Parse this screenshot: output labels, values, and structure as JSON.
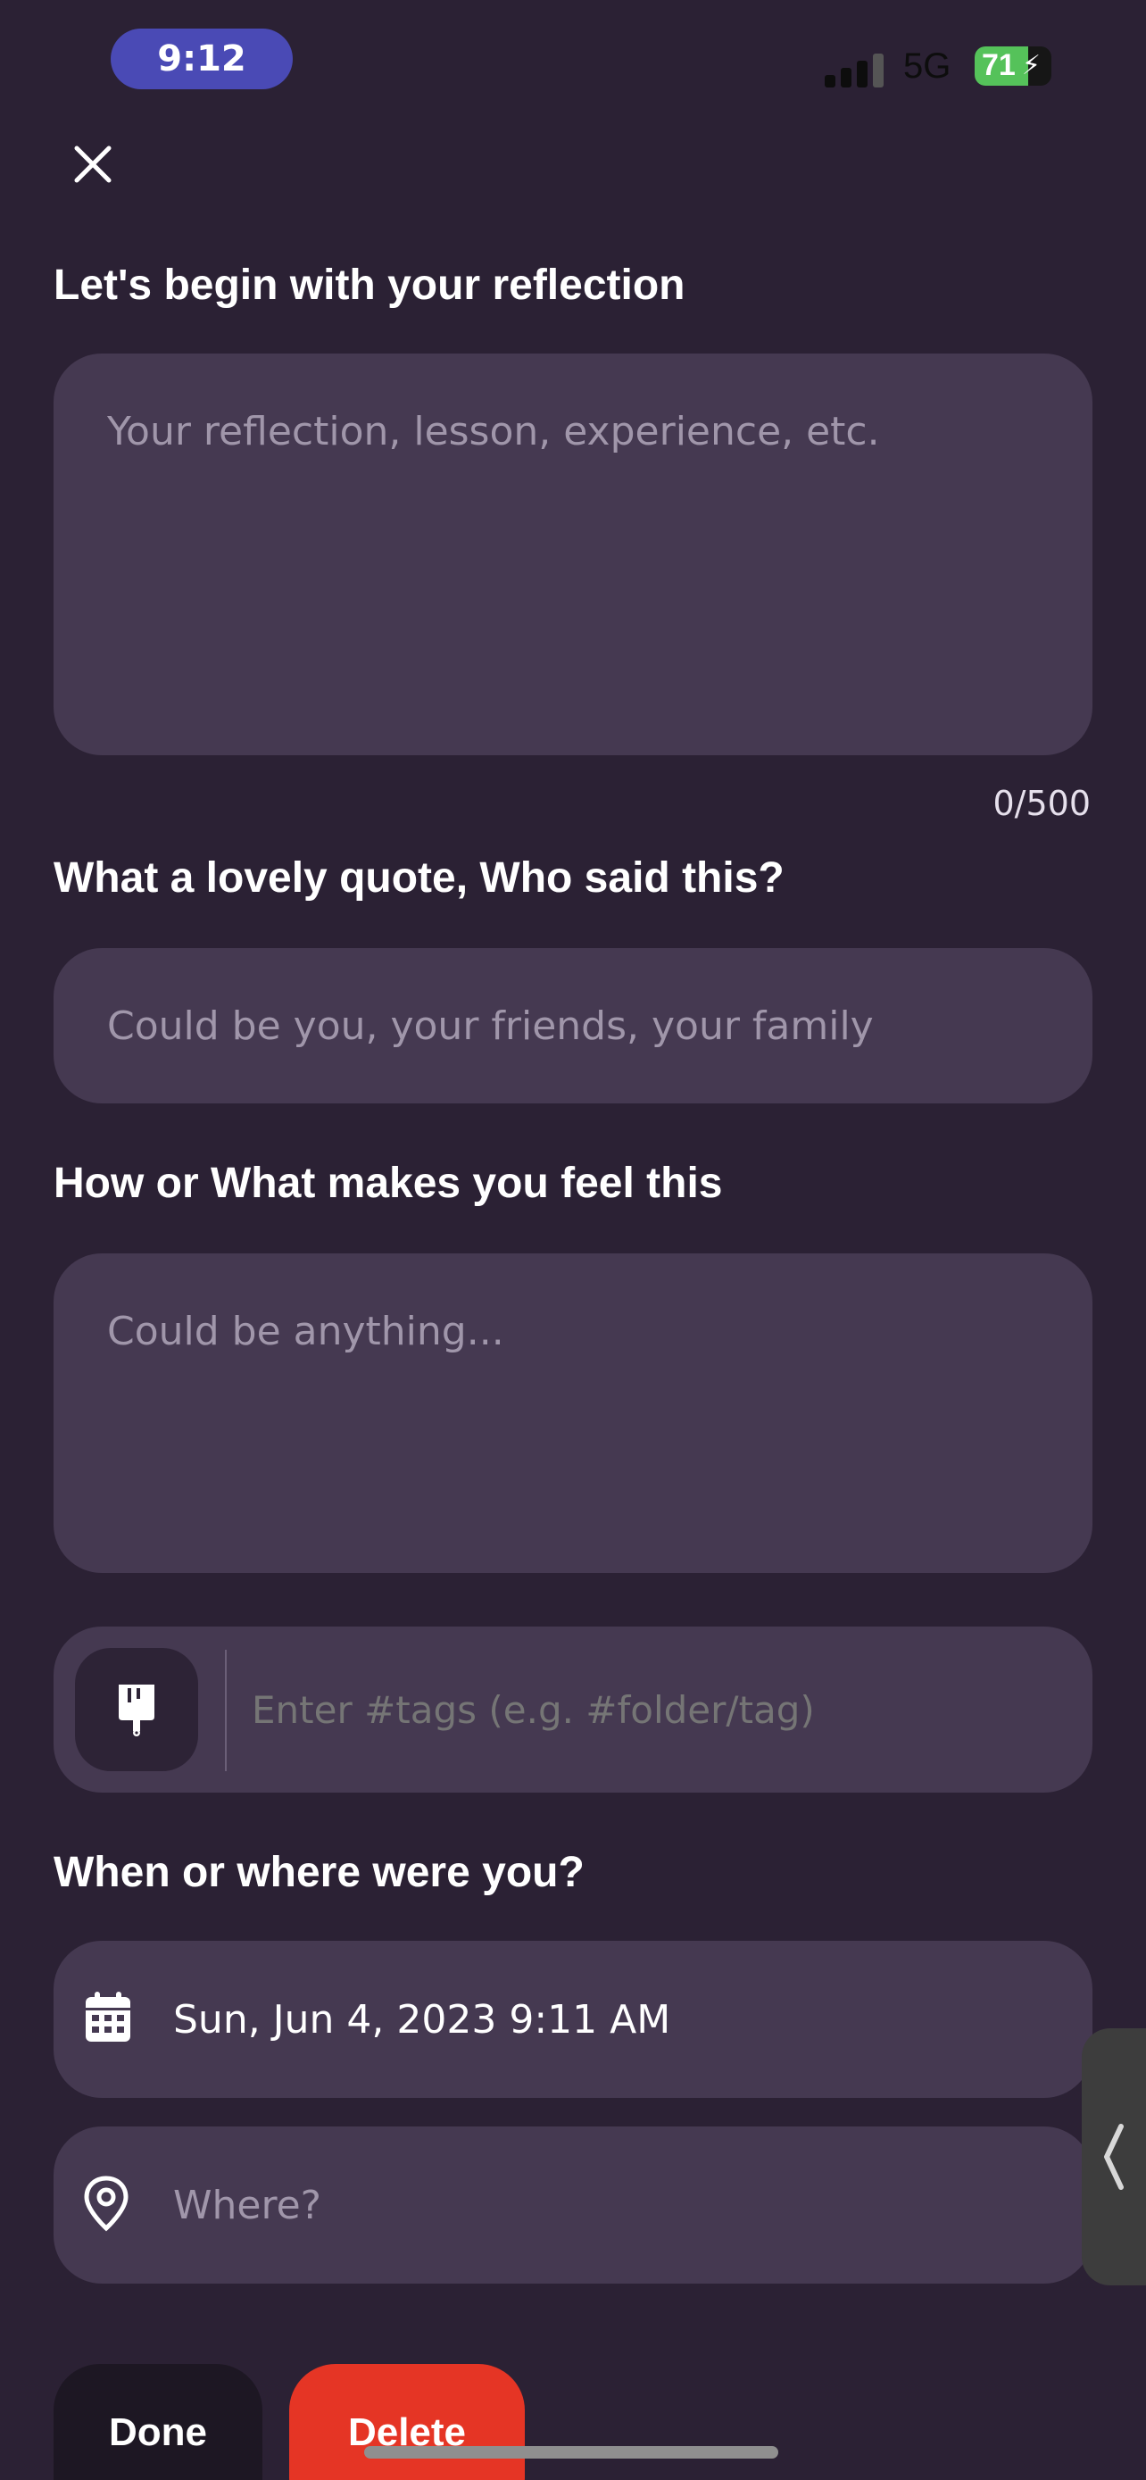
{
  "status_bar": {
    "time": "9:12",
    "network": "5G",
    "battery": "71"
  },
  "form": {
    "reflection": {
      "label": "Let's begin with your reflection",
      "placeholder": "Your reflection, lesson, experience, etc.",
      "value": "",
      "counter": "0/500"
    },
    "quote_author": {
      "label": "What a lovely quote, Who said this?",
      "placeholder": "Could be you, your friends, your family",
      "value": ""
    },
    "feeling": {
      "label": "How or What makes you feel this",
      "placeholder": "Could be anything...",
      "value": ""
    },
    "tags": {
      "placeholder": "Enter #tags (e.g. #folder/tag)",
      "value": ""
    },
    "when_where": {
      "label": "When or where were you?",
      "date": "Sun, Jun 4, 2023 9:11 AM",
      "location_placeholder": "Where?",
      "location_value": ""
    }
  },
  "actions": {
    "done_label": "Done",
    "delete_label": "Delete"
  },
  "colors": {
    "background": "#2b2134",
    "field": "#453951",
    "placeholder": "#a096aa",
    "delete": "#e53525",
    "time_pill": "#4a4ab5",
    "battery": "#55c25a"
  }
}
